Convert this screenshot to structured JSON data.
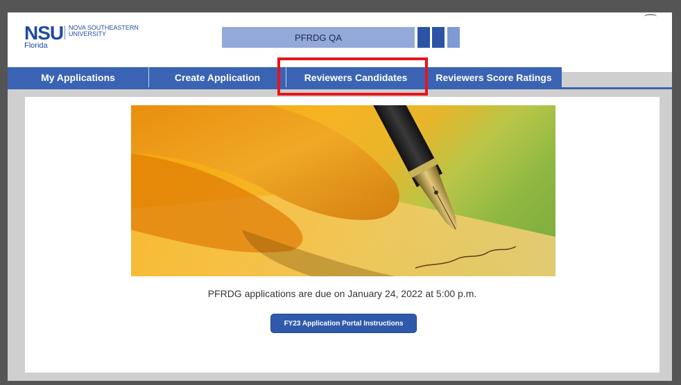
{
  "header": {
    "logo_main": "NSU",
    "logo_line1": "NOVA SOUTHEASTERN",
    "logo_line2": "UNIVERSITY",
    "logo_sub": "Florida",
    "title": "PFRDG QA"
  },
  "nav": {
    "tabs": [
      {
        "label": "My Applications"
      },
      {
        "label": "Create Application"
      },
      {
        "label": "Reviewers Candidates"
      },
      {
        "label": "Reviewers Score Ratings"
      }
    ],
    "highlighted_tab": "Reviewers Candidates"
  },
  "main": {
    "hero_image": "pen-writing-image",
    "due_text": "PFRDG applications are due on January 24, 2022 at 5:00 p.m.",
    "instructions_button": "FY23 Application Portal Instructions"
  },
  "colors": {
    "nav_blue": "#3a64b3",
    "title_bar": "#93a9d9",
    "highlight_red": "#e8131b",
    "button_blue": "#2f5aac"
  }
}
